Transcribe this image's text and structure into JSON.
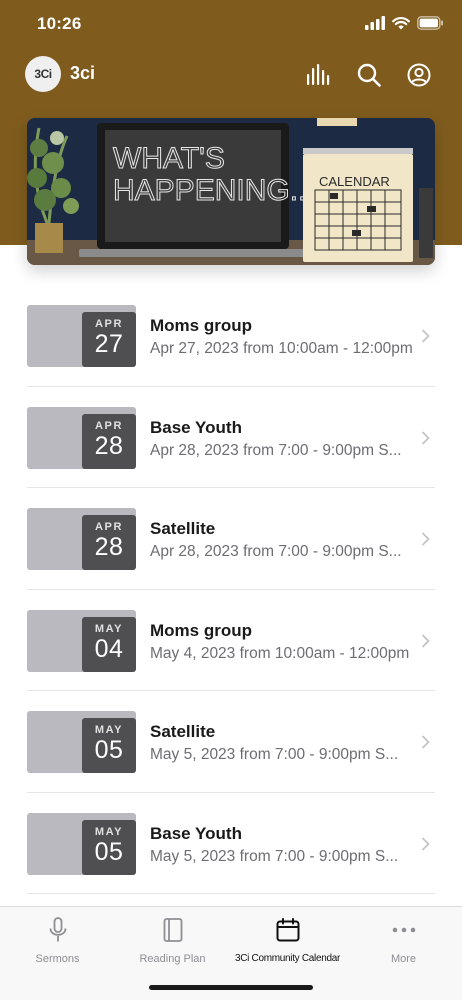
{
  "status_bar": {
    "time": "10:26"
  },
  "app_bar": {
    "avatar_text": "3Ci",
    "title": "3ci",
    "actions": [
      "audio-bars-icon",
      "search-icon",
      "profile-icon"
    ]
  },
  "banner": {
    "headline_line1": "WHAT'S",
    "headline_line2": "HAPPENING...",
    "calendar_label": "CALENDAR"
  },
  "events": [
    {
      "month": "APR",
      "day": "27",
      "title": "Moms group",
      "subtitle": "Apr 27, 2023 from 10:00am - 12:00pm"
    },
    {
      "month": "APR",
      "day": "28",
      "title": "Base Youth",
      "subtitle": "Apr 28, 2023 from 7:00 - 9:00pm S..."
    },
    {
      "month": "APR",
      "day": "28",
      "title": "Satellite",
      "subtitle": "Apr 28, 2023 from 7:00 - 9:00pm S..."
    },
    {
      "month": "MAY",
      "day": "04",
      "title": "Moms group",
      "subtitle": "May 4, 2023 from 10:00am - 12:00pm"
    },
    {
      "month": "MAY",
      "day": "05",
      "title": "Satellite",
      "subtitle": "May 5, 2023 from 7:00 - 9:00pm S..."
    },
    {
      "month": "MAY",
      "day": "05",
      "title": "Base Youth",
      "subtitle": "May 5, 2023 from 7:00 - 9:00pm S..."
    }
  ],
  "tabs": [
    {
      "label": "Sermons",
      "icon": "microphone-icon",
      "active": false
    },
    {
      "label": "Reading Plan",
      "icon": "book-icon",
      "active": false
    },
    {
      "label": "3Ci Community Calendar",
      "icon": "calendar-icon",
      "active": true
    },
    {
      "label": "More",
      "icon": "more-dots-icon",
      "active": false
    }
  ],
  "colors": {
    "header": "#7f5c1e",
    "date_block": "#b9b9bf",
    "date_badge": "#4f4f52",
    "tab_bar": "#f8f8f8"
  }
}
